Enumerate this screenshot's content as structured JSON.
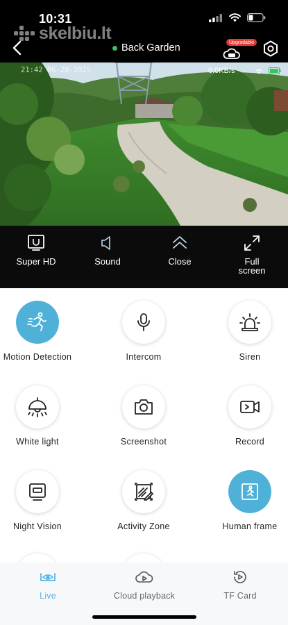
{
  "status_bar": {
    "time": "10:31"
  },
  "watermark": {
    "text": "skelbiu.lt"
  },
  "header": {
    "camera_name": "Back Garden",
    "upgrade_badge": "Upgradable",
    "online_color": "#3ec15f"
  },
  "video": {
    "timestamp": "21:42 06-28-2025",
    "bitrate": "0.0KB/s"
  },
  "controls": [
    {
      "label": "Super HD",
      "icon": "super-hd-icon"
    },
    {
      "label": "Sound",
      "icon": "speaker-muted-icon"
    },
    {
      "label": "Close",
      "icon": "chevron-double-up-icon"
    },
    {
      "label": "Full screen",
      "icon": "fullscreen-icon"
    }
  ],
  "features": [
    {
      "label": "Motion Detection",
      "icon": "running-man-icon",
      "active": true
    },
    {
      "label": "Intercom",
      "icon": "microphone-icon",
      "active": false
    },
    {
      "label": "Siren",
      "icon": "siren-icon",
      "active": false
    },
    {
      "label": "White light",
      "icon": "ceiling-lamp-icon",
      "active": false
    },
    {
      "label": "Screenshot",
      "icon": "camera-icon",
      "active": false
    },
    {
      "label": "Record",
      "icon": "video-record-icon",
      "active": false
    },
    {
      "label": "Night Vision",
      "icon": "monitor-icon",
      "active": false
    },
    {
      "label": "Activity Zone",
      "icon": "crop-zone-icon",
      "active": false
    },
    {
      "label": "Human frame",
      "icon": "human-frame-icon",
      "active": true
    }
  ],
  "tabs": [
    {
      "label": "Live",
      "icon": "live-camera-icon",
      "active": true
    },
    {
      "label": "Cloud playback",
      "icon": "cloud-playback-icon",
      "active": false
    },
    {
      "label": "TF Card",
      "icon": "tf-card-icon",
      "active": false
    }
  ],
  "colors": {
    "accent": "#4fb1d8",
    "tab_active": "#58b6e6",
    "badge": "#e53935"
  }
}
